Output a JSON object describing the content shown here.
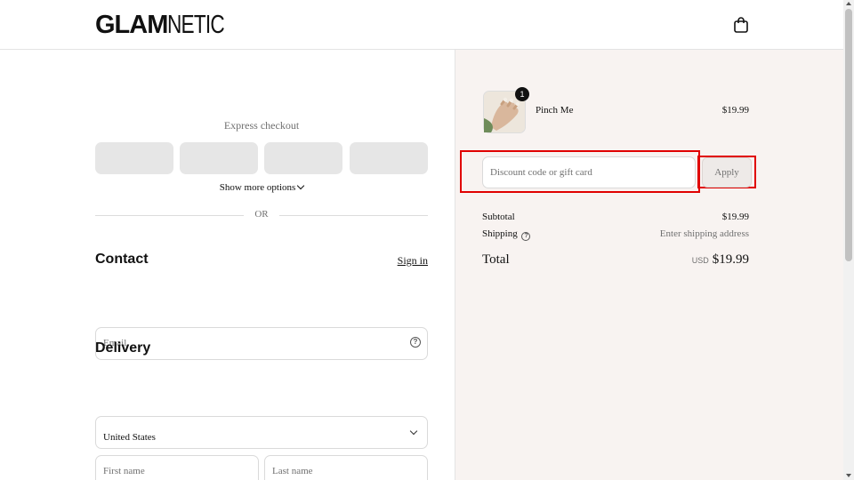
{
  "header": {
    "logo_bold": "GLAM",
    "logo_thin": "NETIC",
    "cart_icon": "shopping-bag-icon"
  },
  "express": {
    "label": "Express checkout",
    "more_options": "Show more options",
    "or_label": "OR"
  },
  "contact": {
    "title": "Contact",
    "sign_in": "Sign in",
    "email_placeholder": "Email"
  },
  "delivery": {
    "title": "Delivery",
    "country_value": "United States",
    "first_name_placeholder": "First name",
    "last_name_placeholder": "Last name"
  },
  "order": {
    "item": {
      "name": "Pinch Me",
      "price": "$19.99",
      "quantity": "1"
    },
    "discount_placeholder": "Discount code or gift card",
    "apply_label": "Apply",
    "subtotal_label": "Subtotal",
    "subtotal_value": "$19.99",
    "shipping_label": "Shipping",
    "shipping_value": "Enter shipping address",
    "total_label": "Total",
    "total_currency": "USD",
    "total_value": "$19.99"
  },
  "colors": {
    "summary_bg": "#f8f3f1",
    "highlight": "#e00000",
    "express_button": "#e6e6e6"
  }
}
